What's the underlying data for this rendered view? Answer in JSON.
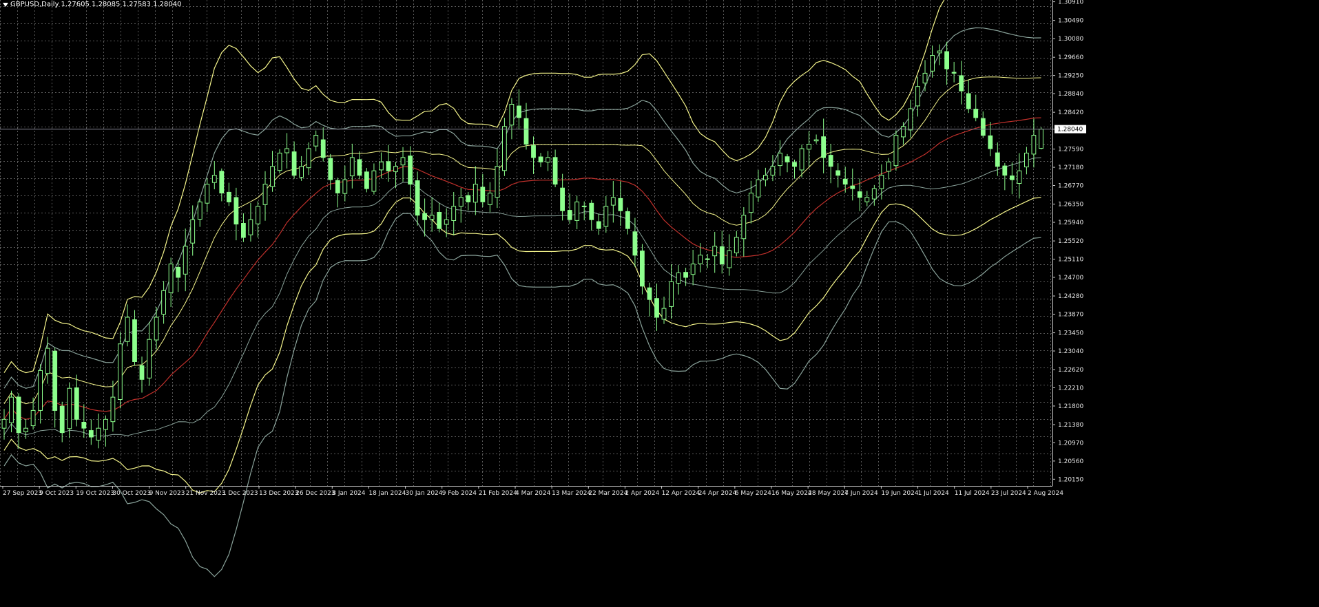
{
  "header": {
    "symbol": "GBPUSD,Daily",
    "ohlc": "1.27605 1.28085 1.27583 1.28040"
  },
  "current_price_label": "1.28040",
  "colors": {
    "background": "#000000",
    "grid": "#5a5a5a",
    "candle": "#8dff8d",
    "upper_band_outer": "#f6f68c",
    "upper_band_inner": "#8aa39b",
    "middle_band": "#c0302b",
    "current_price_line": "#8a8a9a"
  },
  "chart_data": {
    "type": "candlestick",
    "symbol": "GBPUSD",
    "timeframe": "Daily",
    "last_bar": {
      "open": 1.27605,
      "high": 1.28085,
      "low": 1.27583,
      "close": 1.2804
    },
    "y_tick_labels": [
      "1.30910",
      "1.30490",
      "1.30080",
      "1.29660",
      "1.29250",
      "1.28840",
      "1.28420",
      "1.28040",
      "1.27590",
      "1.27180",
      "1.26770",
      "1.26350",
      "1.25940",
      "1.25520",
      "1.25110",
      "1.24700",
      "1.24280",
      "1.23870",
      "1.23450",
      "1.23040",
      "1.22620",
      "1.22210",
      "1.21800",
      "1.21380",
      "1.20970",
      "1.20560",
      "1.20150"
    ],
    "x_tick_labels": [
      "27 Sep 2023",
      "9 Oct 2023",
      "19 Oct 2023",
      "30 Oct 2023",
      "9 Nov 2023",
      "21 Nov 2023",
      "1 Dec 2023",
      "13 Dec 2023",
      "26 Dec 2023",
      "8 Jan 2024",
      "18 Jan 2024",
      "30 Jan 2024",
      "9 Feb 2024",
      "21 Feb 2024",
      "4 Mar 2024",
      "13 Mar 2024",
      "22 Mar 2024",
      "2 Apr 2024",
      "12 Apr 2024",
      "24 Apr 2024",
      "6 May 2024",
      "16 May 2024",
      "28 May 2024",
      "7 Jun 2024",
      "19 Jun 2024",
      "1 Jul 2024",
      "11 Jul 2024",
      "23 Jul 2024",
      "2 Aug 2024"
    ],
    "ylim": [
      1.2,
      1.3095
    ],
    "grid": true,
    "close_path": [
      1.215,
      1.22,
      1.212,
      1.213,
      1.217,
      1.226,
      1.231,
      1.217,
      1.212,
      1.222,
      1.215,
      1.213,
      1.211,
      1.213,
      1.215,
      1.22,
      1.232,
      1.238,
      1.228,
      1.224,
      1.233,
      1.238,
      1.244,
      1.25,
      1.247,
      1.254,
      1.26,
      1.264,
      1.268,
      1.27,
      1.266,
      1.264,
      1.259,
      1.256,
      1.26,
      1.263,
      1.268,
      1.272,
      1.275,
      1.276,
      1.27,
      1.272,
      1.276,
      1.279,
      1.274,
      1.269,
      1.266,
      1.269,
      1.274,
      1.27,
      1.267,
      1.271,
      1.273,
      1.271,
      1.272,
      1.274,
      1.268,
      1.261,
      1.26,
      1.261,
      1.258,
      1.26,
      1.263,
      1.265,
      1.264,
      1.268,
      1.264,
      1.266,
      1.272,
      1.281,
      1.286,
      1.283,
      1.277,
      1.274,
      1.273,
      1.274,
      1.268,
      1.262,
      1.26,
      1.264,
      1.263,
      1.26,
      1.258,
      1.263,
      1.265,
      1.262,
      1.258,
      1.252,
      1.245,
      1.242,
      1.238,
      1.24,
      1.246,
      1.248,
      1.247,
      1.25,
      1.252,
      1.251,
      1.254,
      1.25,
      1.253,
      1.256,
      1.261,
      1.266,
      1.269,
      1.27,
      1.272,
      1.275,
      1.273,
      1.272,
      1.276,
      1.277,
      1.278,
      1.274,
      1.272,
      1.27,
      1.268,
      1.267,
      1.265,
      1.265,
      1.267,
      1.27,
      1.273,
      1.279,
      1.281,
      1.285,
      1.29,
      1.293,
      1.297,
      1.298,
      1.294,
      1.293,
      1.289,
      1.285,
      1.283,
      1.279,
      1.276,
      1.272,
      1.27,
      1.269,
      1.271,
      1.275,
      1.279,
      1.2804
    ]
  }
}
